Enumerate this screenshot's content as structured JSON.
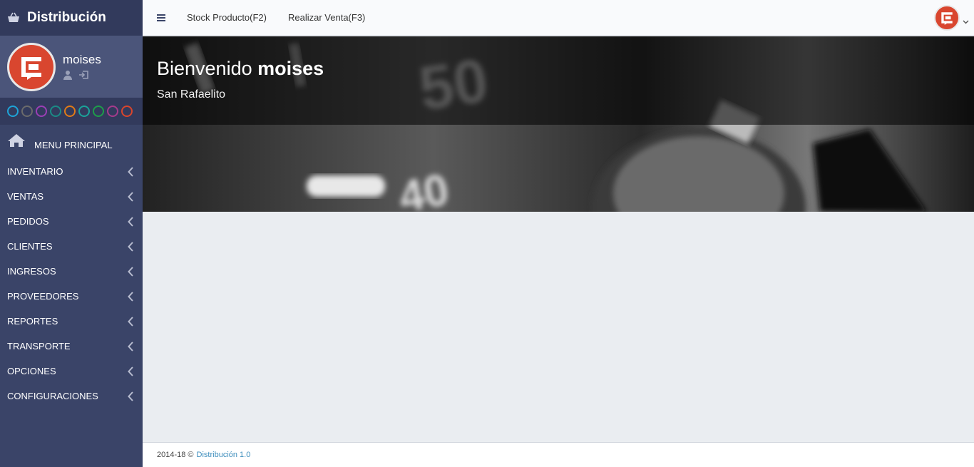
{
  "brand": {
    "title": "Distribución",
    "icon": "basket-icon"
  },
  "user": {
    "name": "moises",
    "icons": [
      "user-icon",
      "logout-icon"
    ]
  },
  "theme_colors": [
    "#1ea4d8",
    "#6b6b6b",
    "#9b3fb5",
    "#1b8b86",
    "#e07b17",
    "#1aa39a",
    "#1e9d4a",
    "#a63b8c",
    "#d9452c"
  ],
  "menu_header": {
    "label": "MENU PRINCIPAL",
    "icon": "home-icon"
  },
  "menu": [
    {
      "label": "INVENTARIO"
    },
    {
      "label": "VENTAS"
    },
    {
      "label": "PEDIDOS"
    },
    {
      "label": "CLIENTES"
    },
    {
      "label": "INGRESOS"
    },
    {
      "label": "PROVEEDORES"
    },
    {
      "label": "REPORTES"
    },
    {
      "label": "TRANSPORTE"
    },
    {
      "label": "OPCIONES"
    },
    {
      "label": "CONFIGURACIONES"
    }
  ],
  "topnav": {
    "links": [
      "Stock Producto(F2)",
      "Realizar Venta(F3)"
    ]
  },
  "banner": {
    "greeting": "Bienvenido",
    "username": "moises",
    "location": "San Rafaelito",
    "image_digits": [
      "50",
      "40"
    ]
  },
  "footer": {
    "text": "2014-18 ©",
    "link": "Distribución 1.0"
  },
  "colors": {
    "sidebar": "#3a4468",
    "accent": "#d9462f",
    "link": "#3c8dbc"
  }
}
